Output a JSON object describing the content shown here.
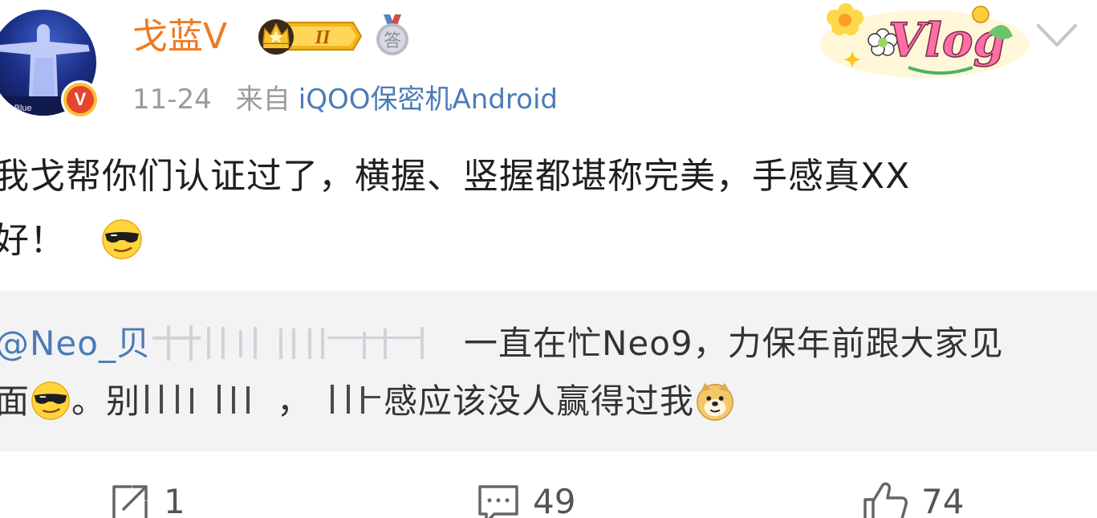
{
  "user": {
    "name": "戈蓝V",
    "avatar_caption": "io Blue",
    "verified_mark": "V",
    "vip_level": "II",
    "medal_label": "答"
  },
  "meta": {
    "date": "11-24",
    "source_prefix": "来自",
    "device": "iQOO保密机Android"
  },
  "sticker": {
    "text": "Vlog"
  },
  "post": {
    "line1": "我戈帮你们认证过了，横握、竖握都堪称完美，手感真XX",
    "line2": "好！"
  },
  "quote": {
    "mention": "@Neo_贝",
    "text1": "一直在忙Neo9，力保年前跟大家见",
    "text2_prefix": "面",
    "text2_a": "。别",
    "text2_b": "，",
    "text2_c": "感应该没人赢得过我"
  },
  "actions": {
    "repost_count": "1",
    "comment_count": "49",
    "like_count": "74"
  },
  "colors": {
    "username": "#ee7a22",
    "link": "#4a7bb7",
    "quote_bg": "#f3f3f3",
    "meta_text": "#9b9b9b"
  },
  "icons": [
    "crown-vip-icon",
    "medal-icon",
    "chevron-down-icon",
    "sunglasses-emoji-icon",
    "doge-emoji-icon",
    "repost-icon",
    "comment-icon",
    "like-icon"
  ]
}
